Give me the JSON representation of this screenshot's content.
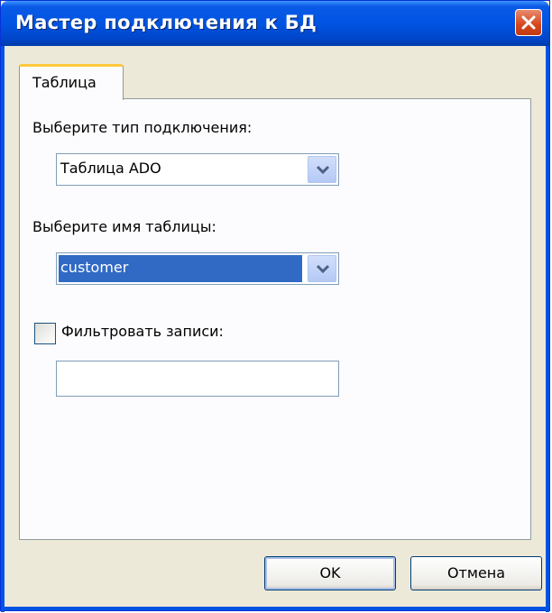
{
  "window": {
    "title": "Мастер подключения к БД"
  },
  "tabs": [
    {
      "label": "Таблица"
    }
  ],
  "form": {
    "connection_type_label": "Выберите тип подключения:",
    "connection_type_value": "Таблица ADO",
    "table_name_label": "Выберите имя таблицы:",
    "table_name_value": "customer",
    "filter_label": "Фильтровать записи:",
    "filter_checked": false,
    "filter_value": ""
  },
  "buttons": {
    "ok": "OK",
    "cancel": "Отмена"
  },
  "colors": {
    "title_bar": "#0054e3",
    "close_button": "#d4461c",
    "selection": "#316ac5",
    "tab_accent": "#ffc83c"
  },
  "icons": {
    "close": "close-icon",
    "dropdown": "chevron-down-icon"
  }
}
